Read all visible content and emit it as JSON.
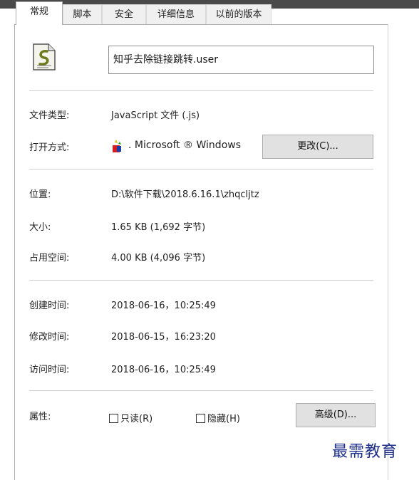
{
  "tabs": [
    "常规",
    "脚本",
    "安全",
    "详细信息",
    "以前的版本"
  ],
  "file_name": "知乎去除链接跳转.user",
  "rows": {
    "type_label": "文件类型:",
    "type_value": "JavaScript 文件 (.js)",
    "opens_label": "打开方式:",
    "opens_value": ". Microsoft ® Windows",
    "change_button": "更改(C)...",
    "location_label": "位置:",
    "location_value": "D:\\软件下载\\2018.6.16.1\\zhqcljtz",
    "size_label": "大小:",
    "size_value": "1.65 KB (1,692 字节)",
    "disk_label": "占用空间:",
    "disk_value": "4.00 KB (4,096 字节)",
    "created_label": "创建时间:",
    "created_value": "2018-06-16，10:25:49",
    "modified_label": "修改时间:",
    "modified_value": "2018-06-15，16:23:20",
    "accessed_label": "访问时间:",
    "accessed_value": "2018-06-16，10:25:49",
    "attr_label": "属性:",
    "readonly_label": "只读(R)",
    "hidden_label": "隐藏(H)",
    "advanced_button": "高级(D)..."
  },
  "watermark": "最需教育",
  "icons": {
    "file": "script-file-icon",
    "app": "windows-script-host-icon"
  }
}
